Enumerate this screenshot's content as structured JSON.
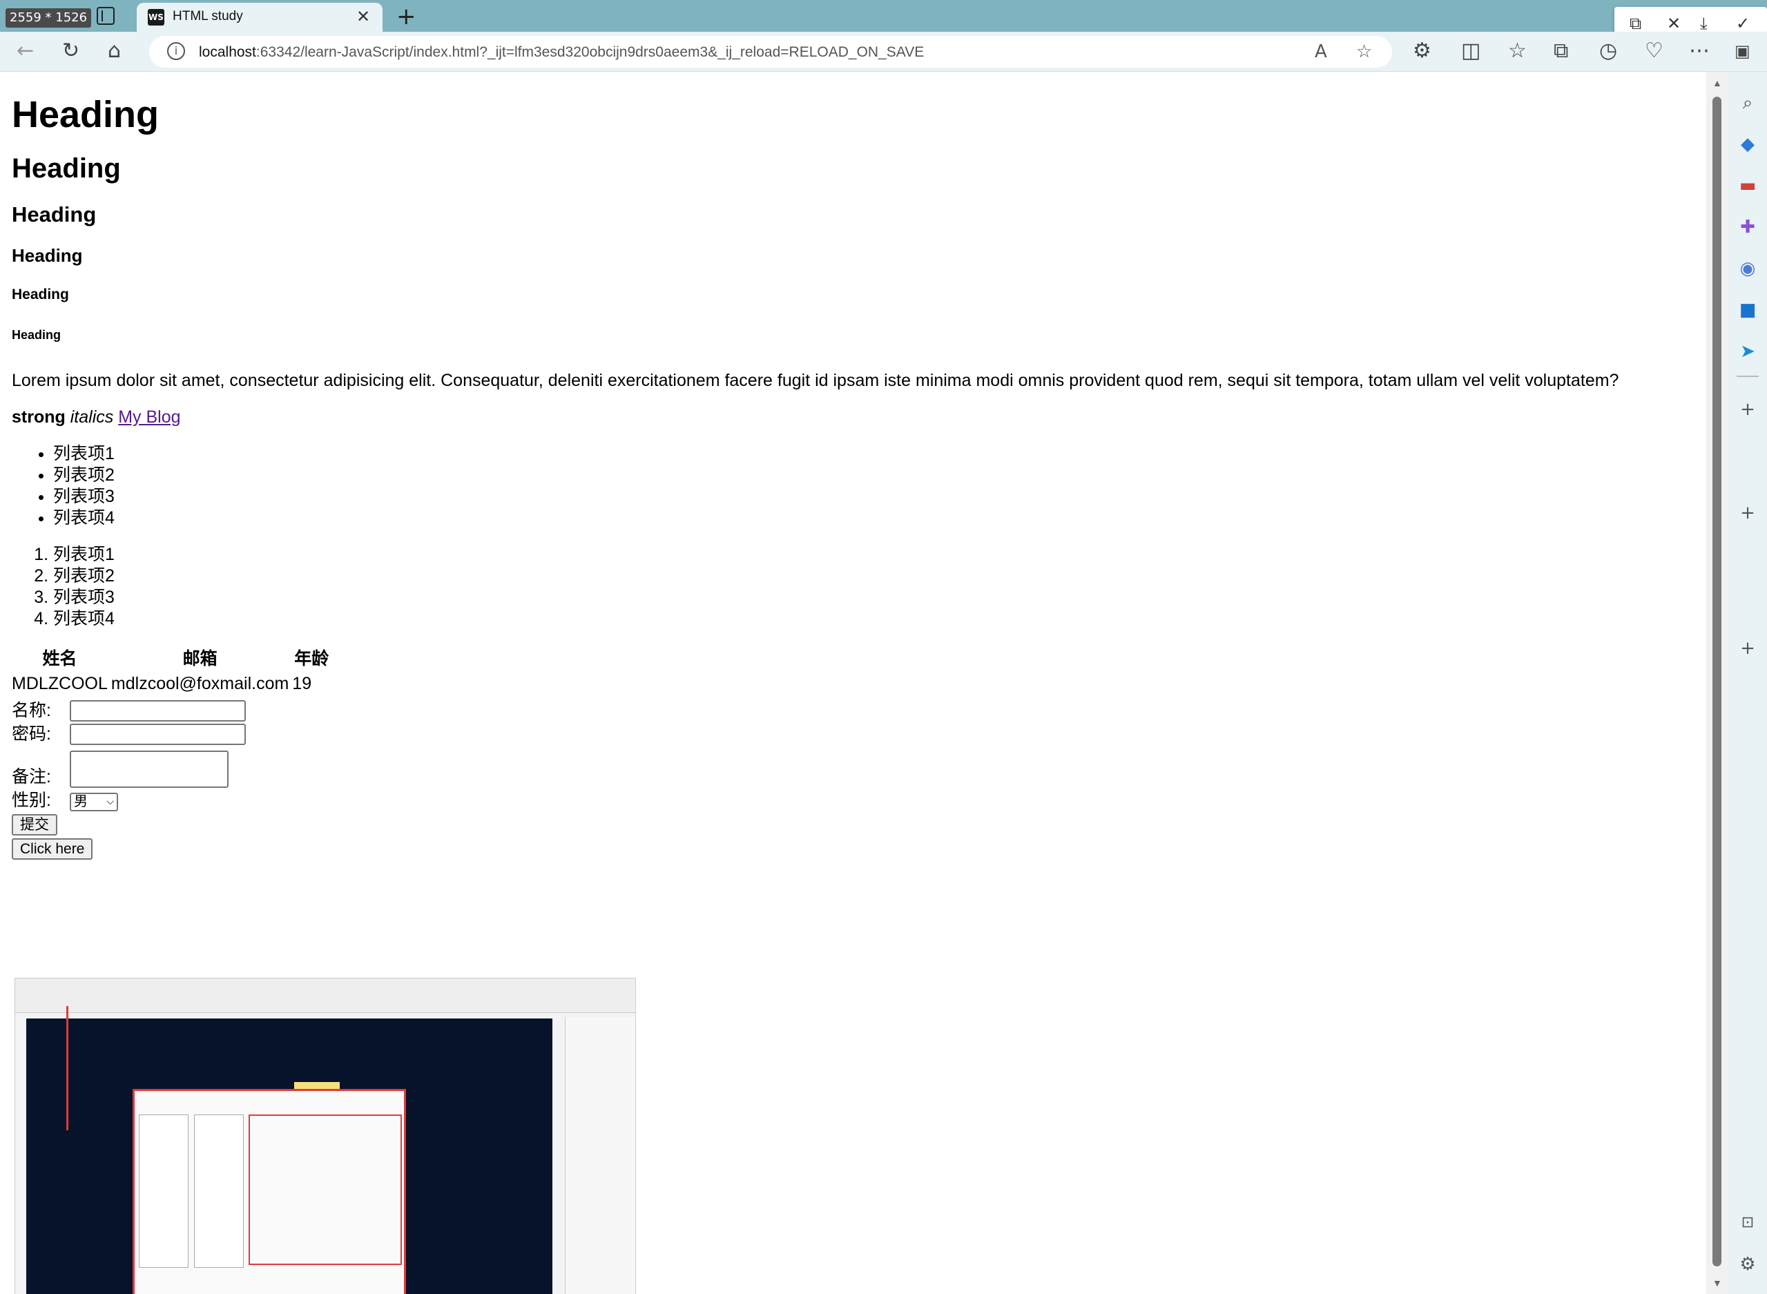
{
  "overlay": {
    "resolution": "2559 * 1526"
  },
  "browser": {
    "tab_title": "HTML study",
    "tab_favicon_text": "WS",
    "url_host": "localhost",
    "url_rest": ":63342/learn-JavaScript/index.html?_ijt=lfm3esd320obcijn9drs0aeem3&_ij_reload=RELOAD_ON_SAVE"
  },
  "page": {
    "h1": "Heading",
    "h2": "Heading",
    "h3": "Heading",
    "h4": "Heading",
    "h5": "Heading",
    "h6": "Heading",
    "paragraph": "Lorem ipsum dolor sit amet, consectetur adipisicing elit. Consequatur, deleniti exercitationem facere fugit id ipsam iste minima modi omnis provident quod rem, sequi sit tempora, totam ullam vel velit voluptatem?",
    "strong": "strong",
    "italics": "italics",
    "link": "My Blog",
    "ul": [
      "列表项1",
      "列表项2",
      "列表项3",
      "列表项4"
    ],
    "ol": [
      "列表项1",
      "列表项2",
      "列表项3",
      "列表项4"
    ],
    "table": {
      "headers": [
        "姓名",
        "邮箱",
        "年龄"
      ],
      "row": [
        "MDLZCOOL",
        "mdlzcool@foxmail.com",
        "19"
      ]
    },
    "form": {
      "name_label": "名称:",
      "password_label": "密码:",
      "note_label": "备注:",
      "gender_label": "性别:",
      "gender_value": "男",
      "submit": "提交"
    },
    "click_button": "Click here"
  }
}
